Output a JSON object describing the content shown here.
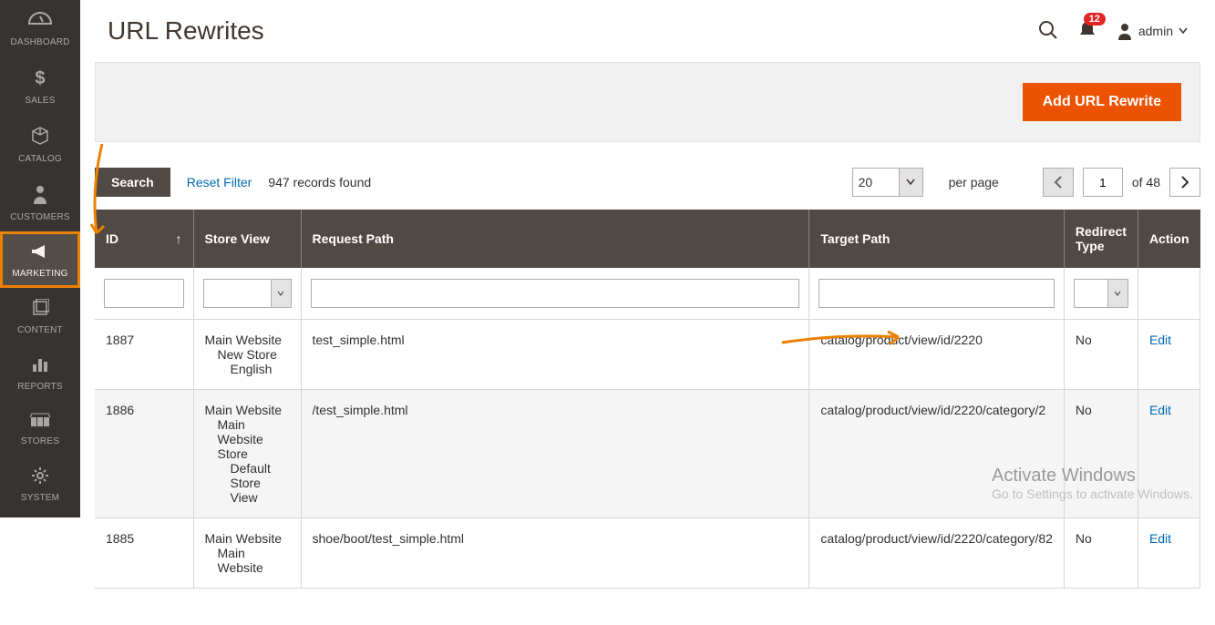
{
  "sidebar": {
    "items": [
      {
        "label": "DASHBOARD",
        "icon": "dashboard"
      },
      {
        "label": "SALES",
        "icon": "dollar"
      },
      {
        "label": "CATALOG",
        "icon": "cube"
      },
      {
        "label": "CUSTOMERS",
        "icon": "person"
      },
      {
        "label": "MARKETING",
        "icon": "megaphone"
      },
      {
        "label": "CONTENT",
        "icon": "sheets"
      },
      {
        "label": "REPORTS",
        "icon": "bars"
      },
      {
        "label": "STORES",
        "icon": "stores"
      },
      {
        "label": "SYSTEM",
        "icon": "gear"
      }
    ]
  },
  "page": {
    "title": "URL Rewrites"
  },
  "header": {
    "notifications": "12",
    "user": "admin"
  },
  "actionbar": {
    "add_btn": "Add URL Rewrite"
  },
  "toolbar": {
    "search": "Search",
    "reset": "Reset Filter",
    "records": "947 records found",
    "per_page_value": "20",
    "per_page_label": "per page",
    "page": "1",
    "of_pages": "of 48"
  },
  "columns": {
    "id": "ID",
    "store": "Store View",
    "request": "Request Path",
    "target": "Target Path",
    "redirect": "Redirect Type",
    "action": "Action"
  },
  "rows": [
    {
      "id": "1887",
      "store": [
        "Main Website",
        "New Store",
        "English"
      ],
      "request": "test_simple.html",
      "target": "catalog/product/view/id/2220",
      "redirect": "No",
      "action": "Edit"
    },
    {
      "id": "1886",
      "store": [
        "Main Website",
        "Main Website Store",
        "Default Store View"
      ],
      "request": "/test_simple.html",
      "target": "catalog/product/view/id/2220/category/2",
      "redirect": "No",
      "action": "Edit"
    },
    {
      "id": "1885",
      "store": [
        "Main Website",
        "Main Website"
      ],
      "request": "shoe/boot/test_simple.html",
      "target": "catalog/product/view/id/2220/category/82",
      "redirect": "No",
      "action": "Edit"
    }
  ],
  "watermark": {
    "line1": "Activate Windows",
    "line2": "Go to Settings to activate Windows."
  }
}
